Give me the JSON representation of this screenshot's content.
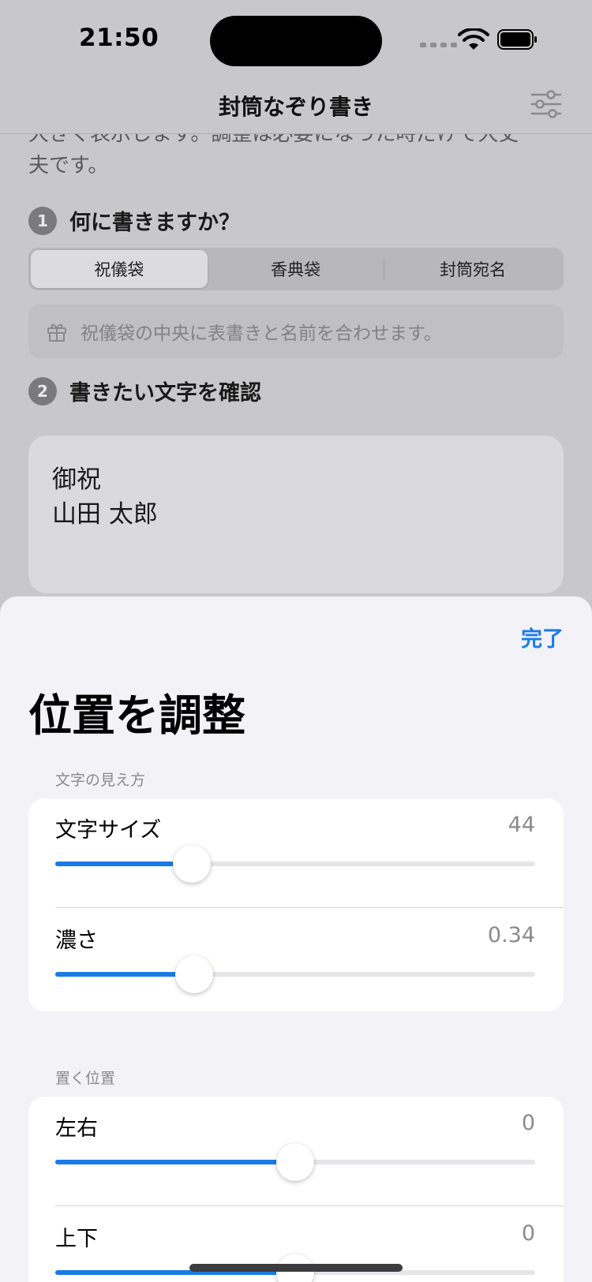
{
  "status_bar": {
    "time": "21:50"
  },
  "nav": {
    "title": "封筒なぞり書き",
    "settings_icon": "sliders-icon"
  },
  "background": {
    "intro_line1": "大きく表示します。調整は必要になった時だけで大丈",
    "intro_line2": "夫です。",
    "step1": {
      "number": "1",
      "title": "何に書きますか？"
    },
    "segments": [
      "祝儀袋",
      "香典袋",
      "封筒宛名"
    ],
    "selected_segment": "祝儀袋",
    "hint": {
      "icon": "gift-icon",
      "text": "祝儀袋の中央に表書きと名前を合わせます。"
    },
    "step2": {
      "number": "2",
      "title": "書きたい文字を確認"
    },
    "text_lines": [
      "御祝",
      "山田 太郎"
    ]
  },
  "sheet": {
    "done_label": "完了",
    "title": "位置を調整",
    "sections": [
      {
        "header": "文字の見え方",
        "rows": [
          {
            "label": "文字サイズ",
            "value": "44",
            "level": 0.285
          },
          {
            "label": "濃さ",
            "value": "0.34",
            "level": 0.29
          }
        ]
      },
      {
        "header": "置く位置",
        "rows": [
          {
            "label": "左右",
            "value": "0",
            "level": 0.5
          },
          {
            "label": "上下",
            "value": "0",
            "level": 0.5
          }
        ]
      }
    ]
  },
  "colors": {
    "accent": "#1a7ae6",
    "sheet_bg": "#f2f2f7",
    "dim_bg": "#c8c8ca"
  }
}
